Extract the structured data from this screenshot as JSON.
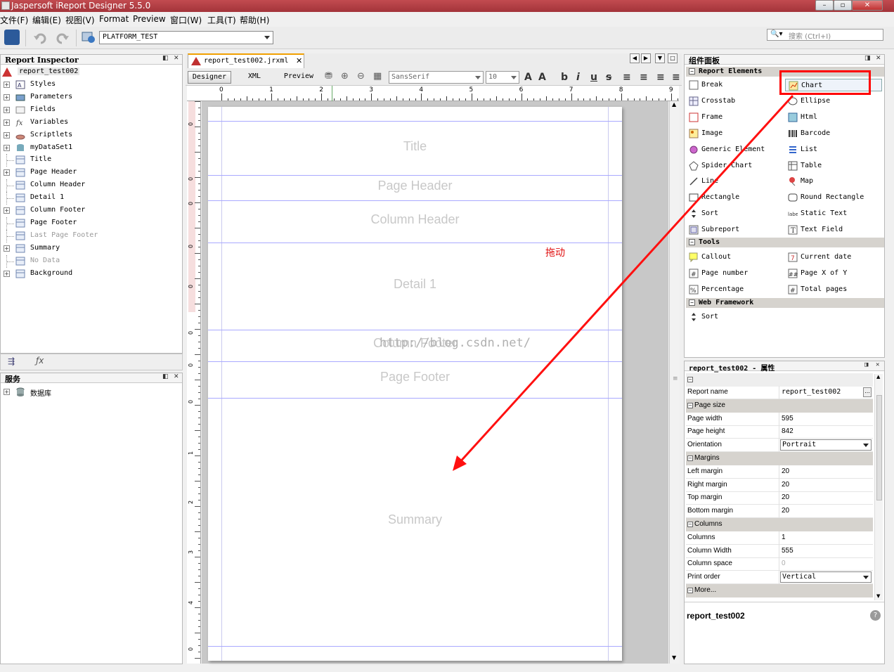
{
  "window": {
    "title": "Jaspersoft iReport Designer 5.5.0"
  },
  "menu": [
    "文件(F)",
    "编辑(E)",
    "视图(V)",
    "Format",
    "Preview",
    "窗口(W)",
    "工具(T)",
    "帮助(H)"
  ],
  "toolbar": {
    "datasource": "PLATFORM_TEST",
    "search_placeholder": "搜索  (Ctrl+I)"
  },
  "inspector": {
    "title": "Report Inspector",
    "root": "report_test002",
    "items": [
      {
        "label": "Styles",
        "expandable": true,
        "icon": "styles-icon"
      },
      {
        "label": "Parameters",
        "expandable": true,
        "icon": "parameters-icon"
      },
      {
        "label": "Fields",
        "expandable": true,
        "icon": "fields-icon"
      },
      {
        "label": "Variables",
        "expandable": true,
        "icon": "variables-icon"
      },
      {
        "label": "Scriptlets",
        "expandable": true,
        "icon": "scriptlets-icon"
      },
      {
        "label": "myDataSet1",
        "expandable": true,
        "icon": "dataset-icon"
      },
      {
        "label": "Title",
        "expandable": false,
        "icon": "band-icon"
      },
      {
        "label": "Page Header",
        "expandable": true,
        "icon": "band-icon"
      },
      {
        "label": "Column Header",
        "expandable": false,
        "icon": "band-icon"
      },
      {
        "label": "Detail 1",
        "expandable": false,
        "icon": "band-icon"
      },
      {
        "label": "Column Footer",
        "expandable": true,
        "icon": "band-icon"
      },
      {
        "label": "Page Footer",
        "expandable": false,
        "icon": "band-icon"
      },
      {
        "label": "Last Page Footer",
        "expandable": false,
        "icon": "band-icon",
        "dim": true
      },
      {
        "label": "Summary",
        "expandable": true,
        "icon": "band-icon"
      },
      {
        "label": "No Data",
        "expandable": false,
        "icon": "band-icon",
        "dim": true
      },
      {
        "label": "Background",
        "expandable": true,
        "icon": "band-icon"
      }
    ]
  },
  "services": {
    "title": "服务",
    "items": [
      "数据库"
    ]
  },
  "editor": {
    "tab_label": "report_test002.jrxml",
    "views": [
      "Designer",
      "XML",
      "Preview"
    ],
    "font_family": "SansSerif",
    "font_size": "10",
    "ruler_marks": [
      "0",
      "1",
      "2",
      "3",
      "4",
      "5",
      "6",
      "7",
      "8",
      "9"
    ],
    "vruler_marks": [
      "0",
      "0",
      "0",
      "0",
      "0",
      "0",
      "0",
      "0",
      "1",
      "2",
      "3",
      "4",
      "0"
    ],
    "bands": [
      "Title",
      "Page Header",
      "Column Header",
      "Detail 1",
      "Column Footer",
      "Page Footer",
      "Summary"
    ],
    "watermark": "http://blog.csdn.net/",
    "annotation": "拖动"
  },
  "palette": {
    "title": "组件面板",
    "categories": [
      {
        "name": "Report Elements",
        "items": [
          {
            "label": "Break",
            "icon": "break-icon"
          },
          {
            "label": "Chart",
            "icon": "chart-icon"
          },
          {
            "label": "Crosstab",
            "icon": "crosstab-icon"
          },
          {
            "label": "Ellipse",
            "icon": "ellipse-icon"
          },
          {
            "label": "Frame",
            "icon": "frame-icon"
          },
          {
            "label": "Html",
            "icon": "html-icon"
          },
          {
            "label": "Image",
            "icon": "image-icon"
          },
          {
            "label": "Barcode",
            "icon": "barcode-icon"
          },
          {
            "label": "Generic Element",
            "icon": "generic-element-icon"
          },
          {
            "label": "List",
            "icon": "list-icon"
          },
          {
            "label": "Spider Chart",
            "icon": "spider-chart-icon"
          },
          {
            "label": "Table",
            "icon": "table-icon"
          },
          {
            "label": "Line",
            "icon": "line-icon"
          },
          {
            "label": "Map",
            "icon": "map-icon"
          },
          {
            "label": "Rectangle",
            "icon": "rectangle-icon"
          },
          {
            "label": "Round Rectangle",
            "icon": "round-rectangle-icon"
          },
          {
            "label": "Sort",
            "icon": "sort-icon"
          },
          {
            "label": "Static Text",
            "icon": "static-text-icon"
          },
          {
            "label": "Subreport",
            "icon": "subreport-icon"
          },
          {
            "label": "Text Field",
            "icon": "text-field-icon"
          }
        ]
      },
      {
        "name": "Tools",
        "items": [
          {
            "label": "Callout",
            "icon": "callout-icon"
          },
          {
            "label": "Current date",
            "icon": "current-date-icon"
          },
          {
            "label": "Page number",
            "icon": "page-number-icon"
          },
          {
            "label": "Page X of Y",
            "icon": "page-x-of-y-icon"
          },
          {
            "label": "Percentage",
            "icon": "percentage-icon"
          },
          {
            "label": "Total pages",
            "icon": "total-pages-icon"
          }
        ]
      },
      {
        "name": "Web Framework",
        "items": [
          {
            "label": "Sort",
            "icon": "sort-icon"
          }
        ]
      }
    ]
  },
  "properties": {
    "title": "report_test002 - 属性",
    "rows": [
      {
        "type": "row",
        "key": "Report name",
        "value": "report_test002",
        "button": true
      },
      {
        "type": "group",
        "key": "Page size"
      },
      {
        "type": "row",
        "key": "Page width",
        "value": "595"
      },
      {
        "type": "row",
        "key": "Page height",
        "value": "842"
      },
      {
        "type": "select",
        "key": "Orientation",
        "value": "Portrait"
      },
      {
        "type": "group",
        "key": "Margins"
      },
      {
        "type": "row",
        "key": "Left margin",
        "value": "20"
      },
      {
        "type": "row",
        "key": "Right margin",
        "value": "20"
      },
      {
        "type": "row",
        "key": "Top margin",
        "value": "20"
      },
      {
        "type": "row",
        "key": "Bottom margin",
        "value": "20"
      },
      {
        "type": "group",
        "key": "Columns"
      },
      {
        "type": "row",
        "key": "Columns",
        "value": "1"
      },
      {
        "type": "row",
        "key": "Column Width",
        "value": "555"
      },
      {
        "type": "row",
        "key": "Column space",
        "value": "0",
        "dim": true
      },
      {
        "type": "select",
        "key": "Print order",
        "value": "Vertical"
      },
      {
        "type": "group",
        "key": "More..."
      }
    ],
    "footer": "report_test002"
  },
  "colors": {
    "titlebar": "#b03c42",
    "highlight": "#ff0000",
    "band_line": "#a9a9ff"
  }
}
